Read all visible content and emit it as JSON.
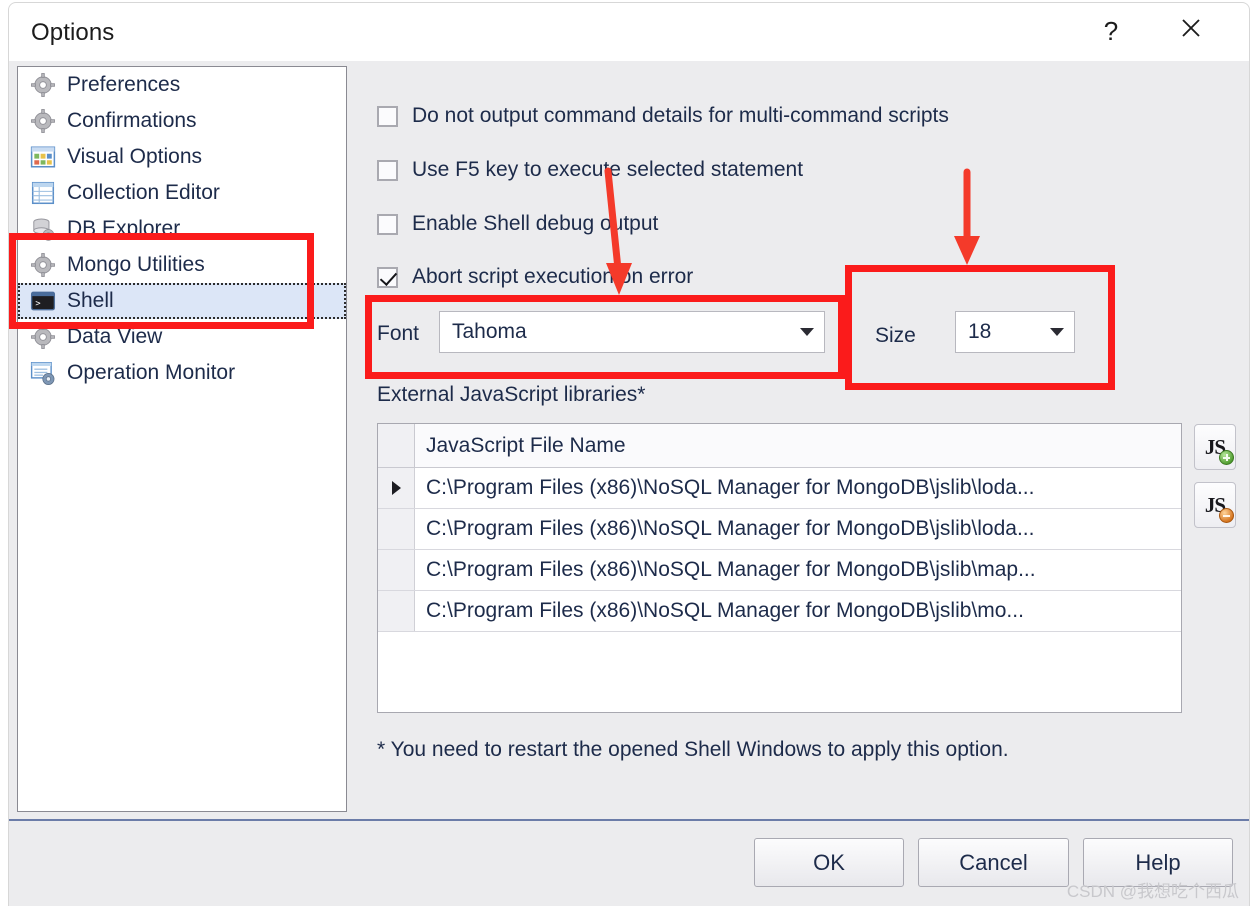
{
  "window": {
    "title": "Options",
    "help_icon": "question-mark-icon",
    "close_icon": "close-x-icon"
  },
  "sidebar": {
    "items": [
      {
        "label": "Preferences",
        "icon": "gear-icon",
        "selected": false
      },
      {
        "label": "Confirmations",
        "icon": "gear-icon",
        "selected": false
      },
      {
        "label": "Visual Options",
        "icon": "color-palette-icon",
        "selected": false
      },
      {
        "label": "Collection Editor",
        "icon": "table-grid-icon",
        "selected": false
      },
      {
        "label": "DB Explorer",
        "icon": "database-gear-icon",
        "selected": false
      },
      {
        "label": "Mongo Utilities",
        "icon": "gear-icon",
        "selected": false
      },
      {
        "label": "Shell",
        "icon": "console-prompt-icon",
        "selected": true
      },
      {
        "label": "Data View",
        "icon": "gear-icon",
        "selected": false
      },
      {
        "label": "Operation Monitor",
        "icon": "monitor-gear-icon",
        "selected": false
      }
    ]
  },
  "panel": {
    "checkboxes": [
      {
        "label": "Do not output command details for multi-command scripts",
        "checked": false
      },
      {
        "label": "Use F5 key to execute selected statement",
        "checked": false
      },
      {
        "label": "Enable Shell debug output",
        "checked": false
      },
      {
        "label": "Abort script execution on error",
        "checked": true
      }
    ],
    "font": {
      "label": "Font",
      "value": "Tahoma",
      "dropdown_icon": "chevron-down-icon"
    },
    "size": {
      "label": "Size",
      "value": "18",
      "dropdown_icon": "chevron-down-icon"
    },
    "libraries_label": "External JavaScript libraries*",
    "grid": {
      "column_header": "JavaScript File Name",
      "rows": [
        {
          "current": true,
          "path": "C:\\Program Files (x86)\\NoSQL Manager for MongoDB\\jslib\\loda..."
        },
        {
          "current": false,
          "path": "C:\\Program Files (x86)\\NoSQL Manager for MongoDB\\jslib\\loda..."
        },
        {
          "current": false,
          "path": "C:\\Program Files (x86)\\NoSQL Manager for MongoDB\\jslib\\map..."
        },
        {
          "current": false,
          "path": "C:\\Program Files (x86)\\NoSQL Manager for MongoDB\\jslib\\mo..."
        }
      ]
    },
    "side_buttons": [
      {
        "name": "add-js-library-button",
        "glyph": "JS",
        "badge": "add-green-plus-icon"
      },
      {
        "name": "remove-js-library-button",
        "glyph": "JS",
        "badge": "remove-orange-minus-icon"
      }
    ],
    "footnote": "* You need to restart the opened Shell Windows to apply this option."
  },
  "footer": {
    "ok": "OK",
    "cancel": "Cancel",
    "help": "Help"
  },
  "watermark": "CSDN @我想吃个西瓜",
  "annotations": {
    "accent_color": "#fb1b1b",
    "boxes": [
      "sidebar-mongo-utilities-shell",
      "font-row",
      "size-row"
    ],
    "arrows": [
      "arrow-to-font-row",
      "arrow-to-size-row"
    ]
  }
}
